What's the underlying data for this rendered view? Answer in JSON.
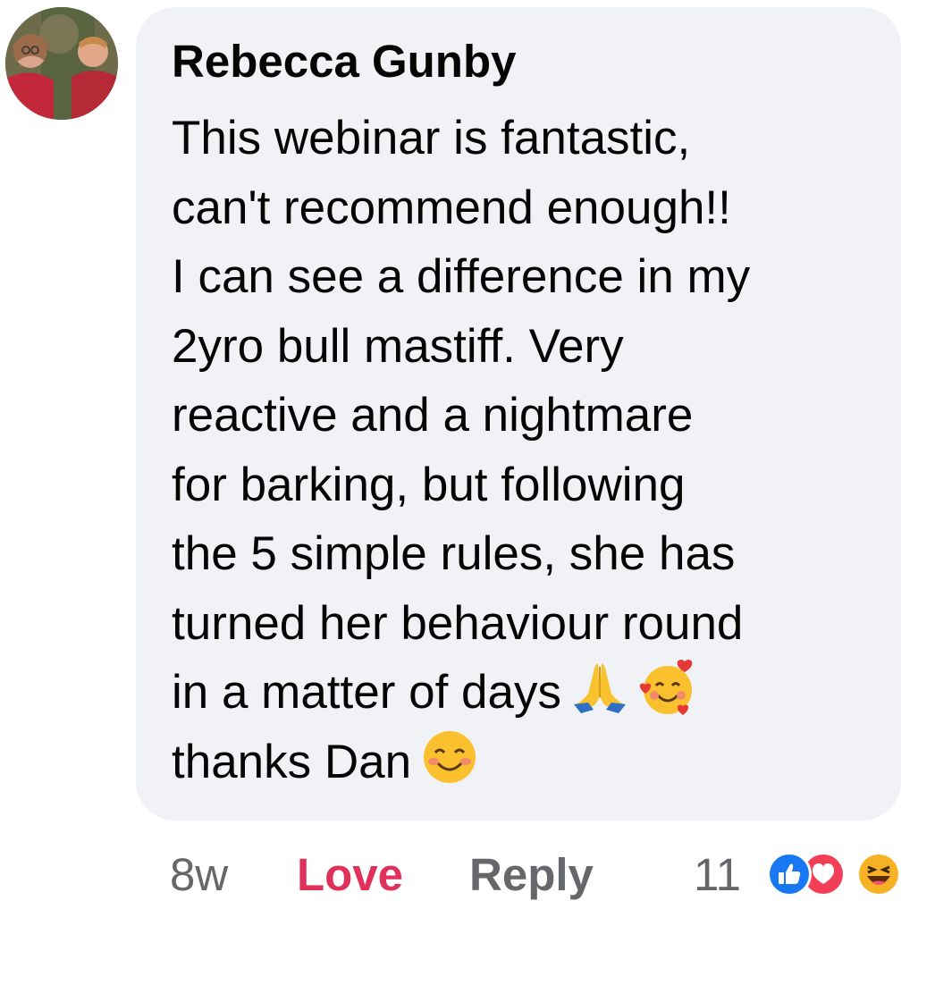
{
  "comment": {
    "author": "Rebecca Gunby",
    "lines": [
      "This webinar is fantastic,",
      "can't recommend enough!!",
      "I can see a difference in my",
      "2yro bull mastiff. Very",
      "reactive and a nightmare",
      "for barking, but following",
      "the 5 simple rules, she has",
      "turned her behaviour round",
      "in a matter of days",
      "thanks Dan"
    ],
    "inline_emojis": {
      "line_9": [
        "folded-hands-emoji",
        "smiling-face-with-hearts-emoji"
      ],
      "line_10": [
        "smiling-face-with-smiling-eyes-emoji"
      ]
    }
  },
  "actions": {
    "time": "8w",
    "love_label": "Love",
    "reply_label": "Reply"
  },
  "reactions": {
    "count": "11",
    "icons": [
      "like-reaction-icon",
      "love-reaction-icon",
      "haha-reaction-icon"
    ],
    "colors": {
      "like": "#1877f2",
      "love": "#f33e58",
      "haha": "#f7b125"
    }
  },
  "colors": {
    "bubble": "#f0f2f5",
    "text": "#050505",
    "muted": "#65676b",
    "love_active": "#e0315b"
  }
}
